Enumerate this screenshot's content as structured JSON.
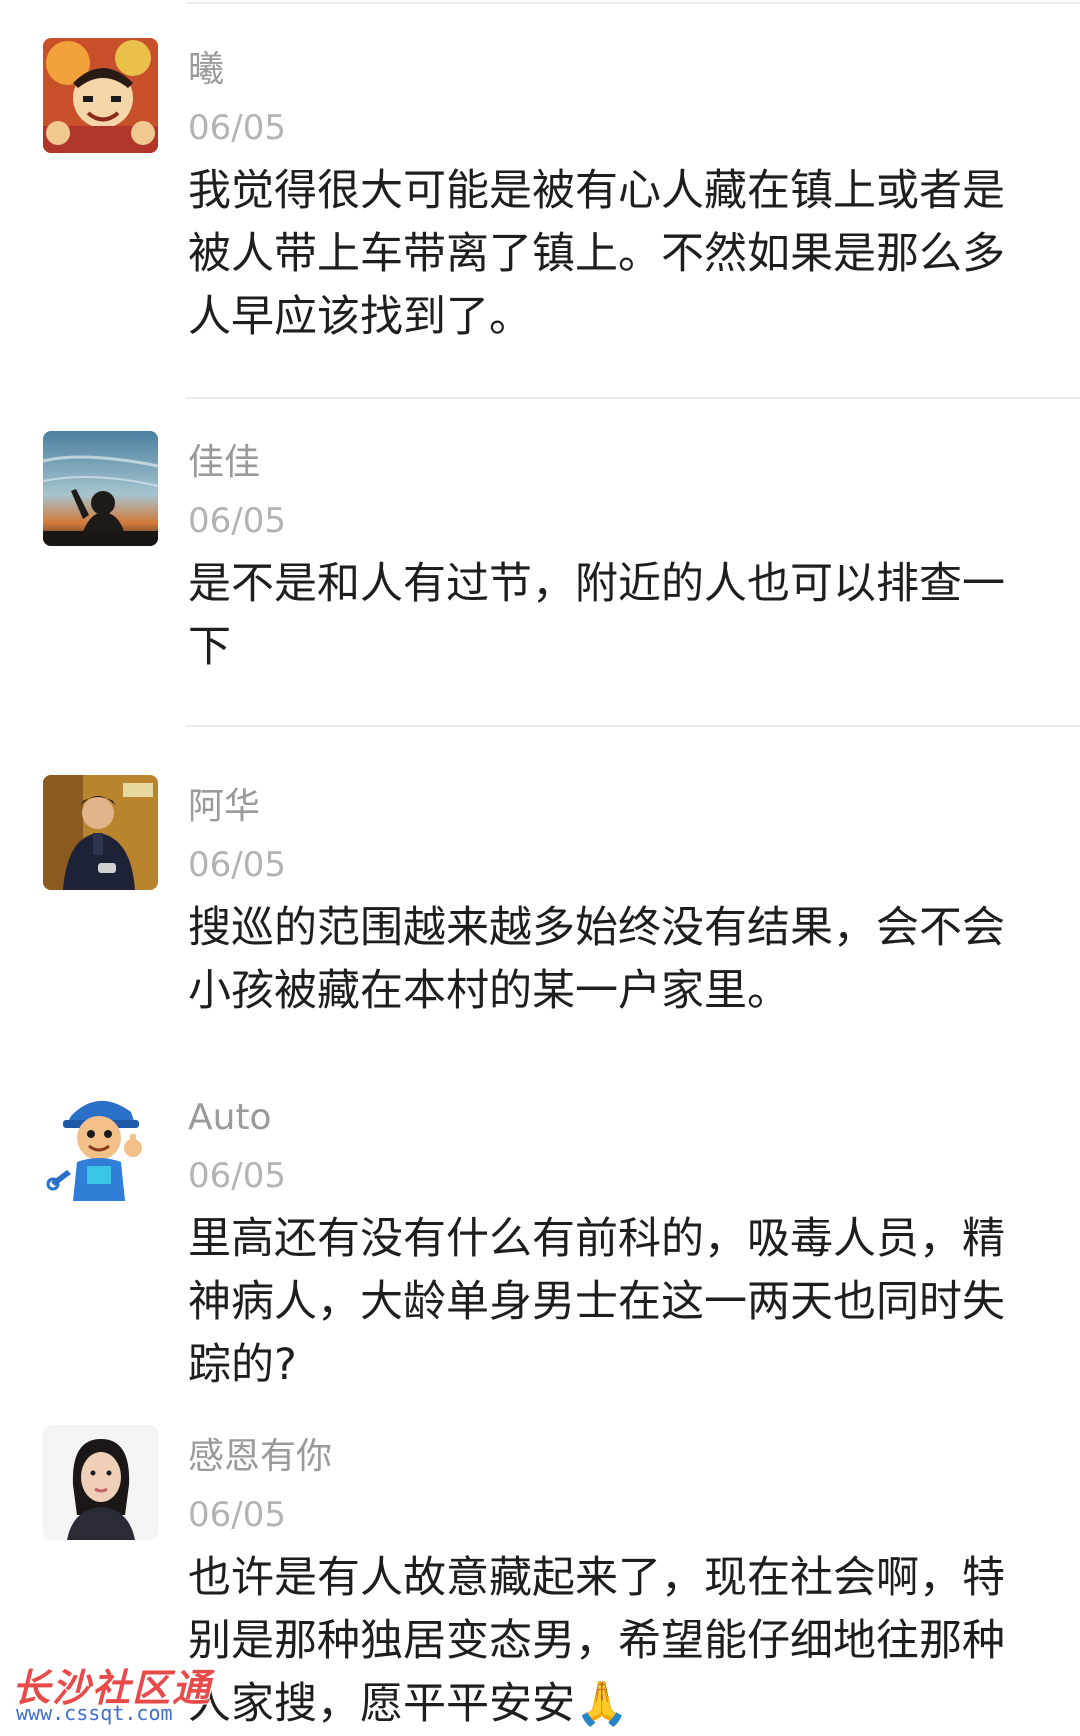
{
  "comments": [
    {
      "nickname": "曦",
      "date": "06/05",
      "text": "我觉得很大可能是被有心人藏在镇上或者是被人带上车带离了镇上。不然如果是那么多人早应该找到了。",
      "avatar": "anime-avatar-icon"
    },
    {
      "nickname": "佳佳",
      "date": "06/05",
      "text": "是不是和人有过节，附近的人也可以排查一下",
      "avatar": "sunset-silhouette-avatar-icon"
    },
    {
      "nickname": "阿华",
      "date": "06/05",
      "text": "搜巡的范围越来越多始终没有结果，会不会小孩被藏在本村的某一户家里。",
      "avatar": "man-portrait-avatar-icon"
    },
    {
      "nickname": "Auto",
      "date": "06/05",
      "text": "里高还有没有什么有前科的，吸毒人员，精神病人，大龄单身男士在这一两天也同时失踪的?",
      "avatar": "mechanic-cartoon-avatar-icon"
    },
    {
      "nickname": "感恩有你",
      "date": "06/05",
      "text": "也许是有人故意藏起来了，现在社会啊，特别是那种独居变态男，希望能仔细地往那种人家搜，愿平平安安🙏",
      "avatar": "woman-portrait-avatar-icon"
    }
  ],
  "watermark": {
    "title": "长沙社区通",
    "url": "www.cssqt.com"
  },
  "colors": {
    "nickname": "#9a9a9a",
    "date": "#b3b3b3",
    "body": "#1e1e1e",
    "divider": "#ededed",
    "watermark_red": "#e84a4a",
    "watermark_blue": "#3d6fd1"
  }
}
